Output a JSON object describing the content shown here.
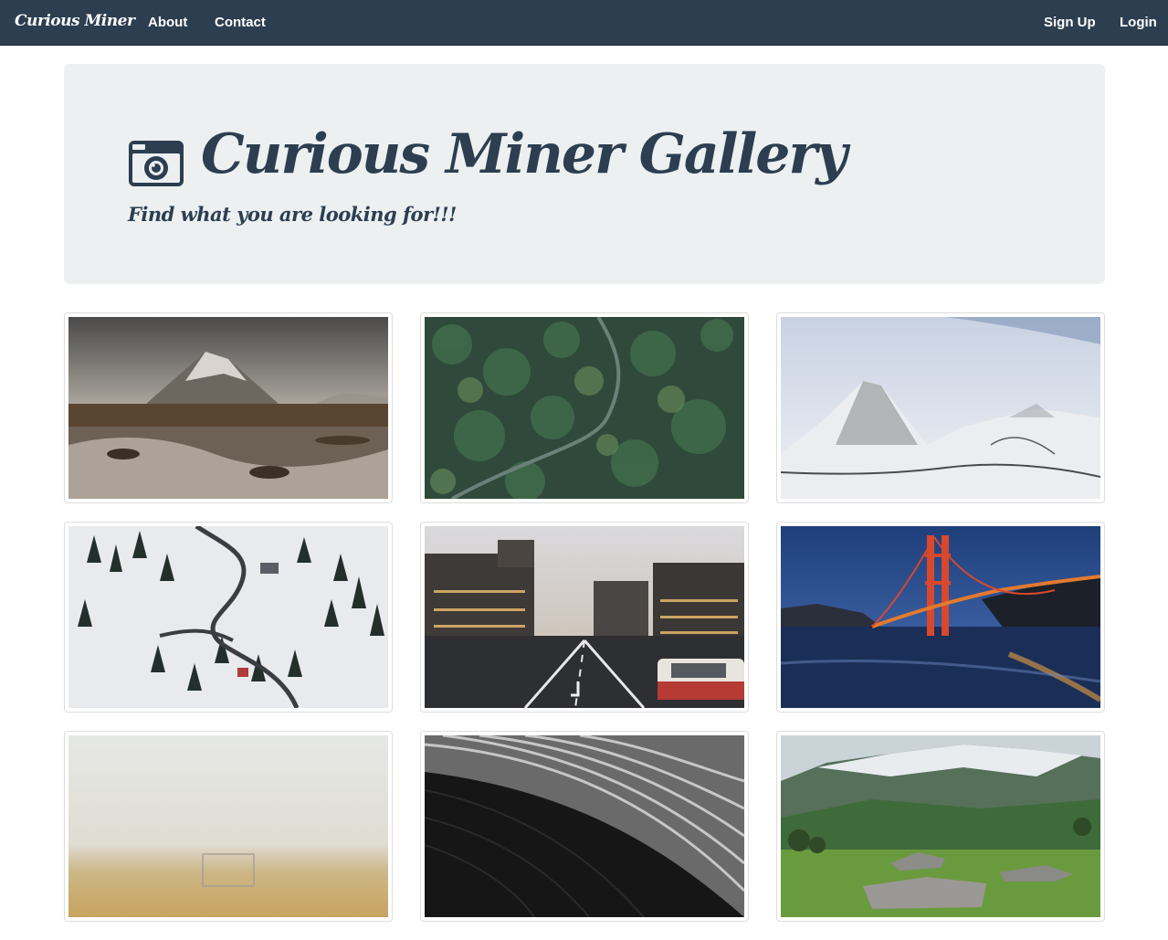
{
  "navbar": {
    "brand": "Curious Miner",
    "links": [
      "About",
      "Contact"
    ],
    "right_links": [
      "Sign Up",
      "Login"
    ]
  },
  "jumbotron": {
    "icon": "camera-icon",
    "title": "Curious Miner Gallery",
    "subtitle": "Find what you are looking for!!!"
  },
  "gallery": {
    "images": [
      "snowy-mountain-river",
      "aerial-forest-road",
      "snow-covered-mountains",
      "snowy-village-aerial",
      "city-street-dusk-taxi",
      "golden-gate-bridge-night",
      "foggy-field-goal",
      "black-white-architecture",
      "green-mountain-valley"
    ]
  }
}
